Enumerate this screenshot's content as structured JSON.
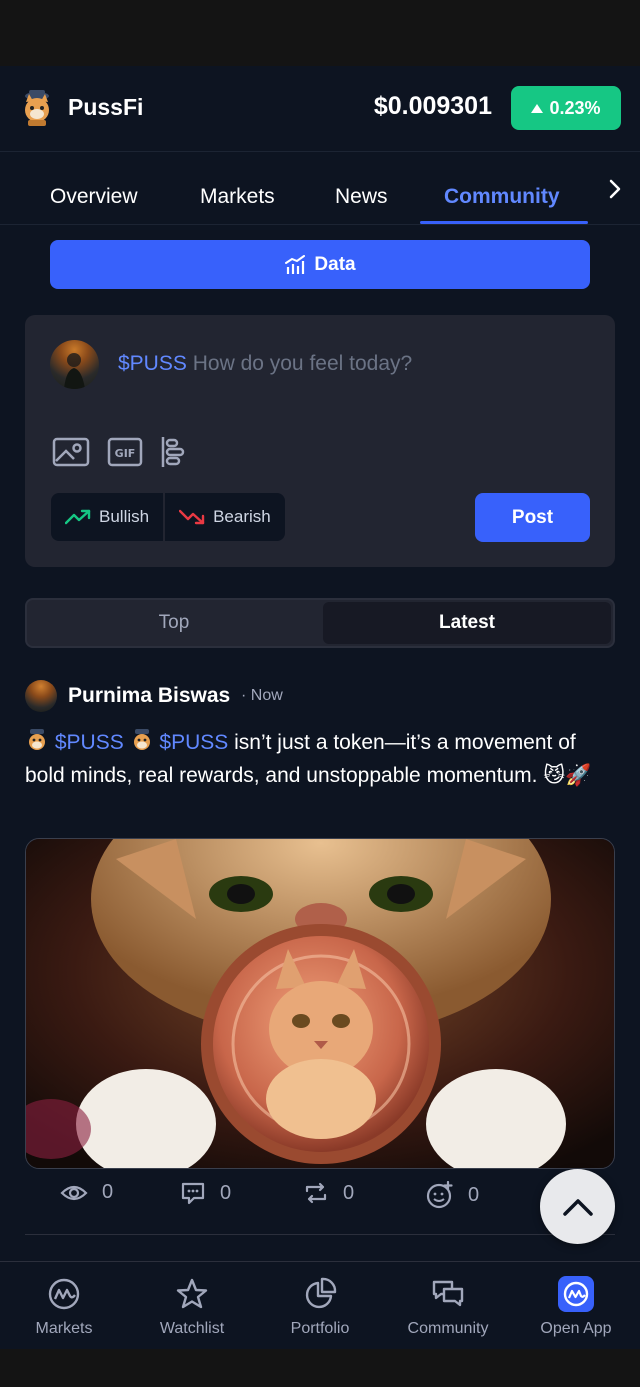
{
  "header": {
    "brand": "PussFi",
    "price": "$0.009301",
    "change": "0.23%",
    "change_color": "#16c784"
  },
  "tabs": [
    {
      "label": "Overview"
    },
    {
      "label": "Markets"
    },
    {
      "label": "News"
    },
    {
      "label": "Community",
      "active": true
    }
  ],
  "data_button": {
    "label": "Data",
    "icon": "chart-icon"
  },
  "composer": {
    "cashtag": "$PUSS",
    "placeholder": "How do you feel today?",
    "tools": [
      "image-icon",
      "gif-icon",
      "poll-icon"
    ],
    "bullish": "Bullish",
    "bearish": "Bearish",
    "post": "Post"
  },
  "feed_toggle": {
    "top": "Top",
    "latest": "Latest",
    "selected": "Latest"
  },
  "post": {
    "author": "Purnima Biswas",
    "time": "· Now",
    "cashtag1": "$PUSS",
    "cashtag2": "$PUSS",
    "text_line": "isn’t just a token—it’s a movement of bold minds, real rewards, and unstoppable momentum.",
    "emoji": "😼🚀",
    "stats": {
      "views": "0",
      "comments": "0",
      "reposts": "0",
      "reactions": "0"
    }
  },
  "bottom_nav": [
    {
      "label": "Markets",
      "icon": "cmc-logo-icon"
    },
    {
      "label": "Watchlist",
      "icon": "star-icon"
    },
    {
      "label": "Portfolio",
      "icon": "pie-chart-icon"
    },
    {
      "label": "Community",
      "icon": "chat-icon"
    },
    {
      "label": "Open App",
      "icon": "cmc-app-icon"
    }
  ],
  "colors": {
    "accent": "#3861fb",
    "link": "#6188ff",
    "bullish": "#16c784",
    "bearish": "#ea3943",
    "background": "#0d1421"
  }
}
